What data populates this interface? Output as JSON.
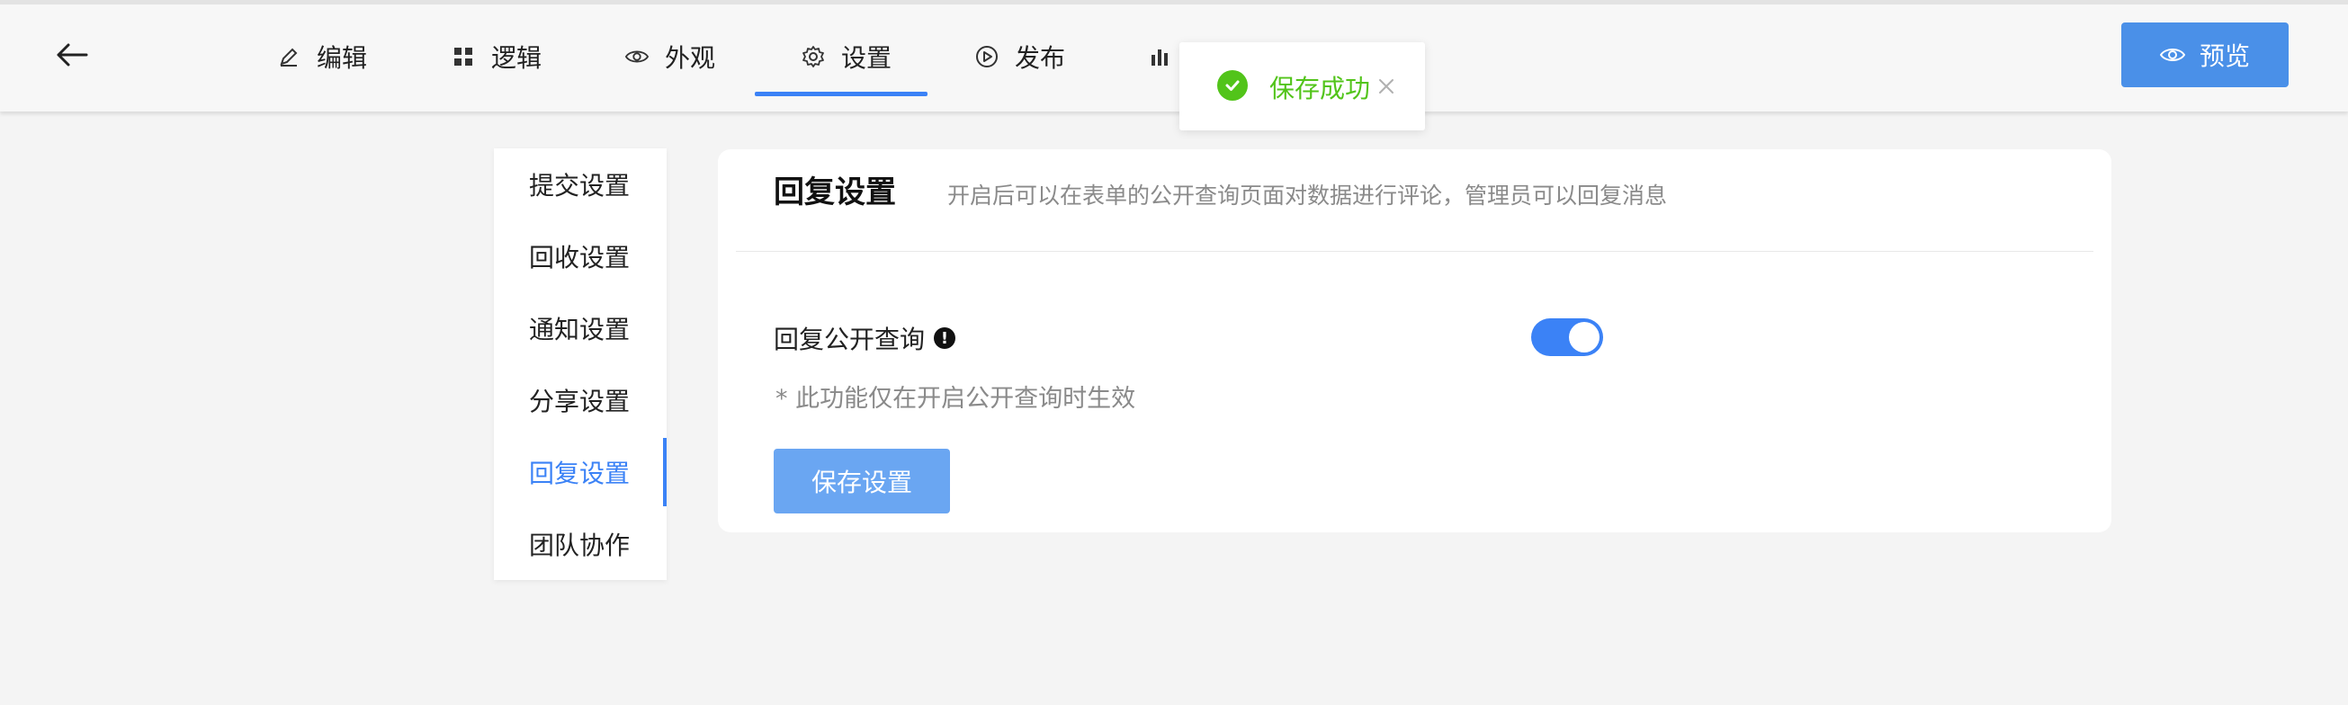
{
  "header": {
    "back_icon": "arrow-left-icon",
    "tabs": [
      {
        "label": "编辑",
        "icon": "pen-icon"
      },
      {
        "label": "逻辑",
        "icon": "grid-icon"
      },
      {
        "label": "外观",
        "icon": "eye-icon"
      },
      {
        "label": "设置",
        "icon": "gear-icon",
        "active": true
      },
      {
        "label": "发布",
        "icon": "play-circle-icon"
      },
      {
        "label": "",
        "icon": "bar-chart-icon"
      }
    ],
    "preview_label": "预览"
  },
  "toast": {
    "message": "保存成功",
    "color": "#52c41a"
  },
  "side_menu": {
    "items": [
      {
        "label": "提交设置"
      },
      {
        "label": "回收设置"
      },
      {
        "label": "通知设置"
      },
      {
        "label": "分享设置"
      },
      {
        "label": "回复设置",
        "active": true
      },
      {
        "label": "团队协作"
      }
    ]
  },
  "panel": {
    "title": "回复设置",
    "description": "开启后可以在表单的公开查询页面对数据进行评论，管理员可以回复消息",
    "field_label": "回复公开查询",
    "toggle_on": true,
    "hint": "* 此功能仅在开启公开查询时生效",
    "save_label": "保存设置"
  },
  "colors": {
    "accent": "#3b82f6",
    "preview_button": "#4a90e8",
    "save_button": "#6aa6f2",
    "success": "#52c41a"
  }
}
